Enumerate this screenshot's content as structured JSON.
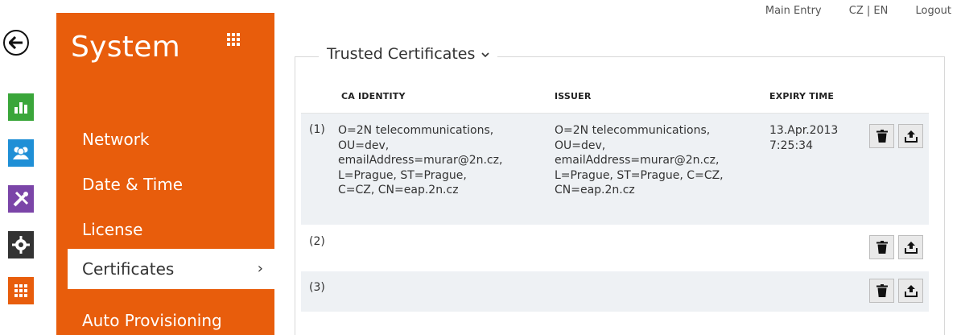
{
  "toplinks": {
    "main_entry": "Main Entry",
    "language": "CZ | EN",
    "logout": "Logout"
  },
  "sidebar": {
    "title": "System",
    "items": [
      {
        "label": "Network"
      },
      {
        "label": "Date & Time"
      },
      {
        "label": "License"
      },
      {
        "label": "Certificates",
        "active": true
      },
      {
        "label": "Auto Provisioning"
      }
    ],
    "active_chevron": "›"
  },
  "rail": {
    "icons": [
      "back-arrow-icon",
      "bar-chart-icon",
      "users-icon",
      "tools-icon",
      "gear-icon",
      "grid-icon"
    ],
    "colors": {
      "green": "#3aa63a",
      "blue": "#1f8fd6",
      "purple": "#7b45a8",
      "dark": "#333333",
      "orange": "#e85d0c"
    }
  },
  "section": {
    "title": "Trusted Certificates",
    "columns": [
      "CA IDENTITY",
      "ISSUER",
      "EXPIRY TIME"
    ],
    "rows": [
      {
        "index": "(1)",
        "ca_identity": [
          "O=2N telecommunications,",
          "OU=dev,",
          "emailAddress=murar@2n.cz,",
          "L=Prague, ST=Prague,",
          "C=CZ, CN=eap.2n.cz"
        ],
        "issuer": [
          "O=2N telecommunications,",
          "OU=dev,",
          "emailAddress=murar@2n.cz,",
          "L=Prague, ST=Prague, C=CZ,",
          "CN=eap.2n.cz"
        ],
        "expiry": [
          "13.Apr.2013",
          "7:25:34"
        ]
      },
      {
        "index": "(2)"
      },
      {
        "index": "(3)"
      }
    ]
  },
  "accent": "#e85d0c"
}
